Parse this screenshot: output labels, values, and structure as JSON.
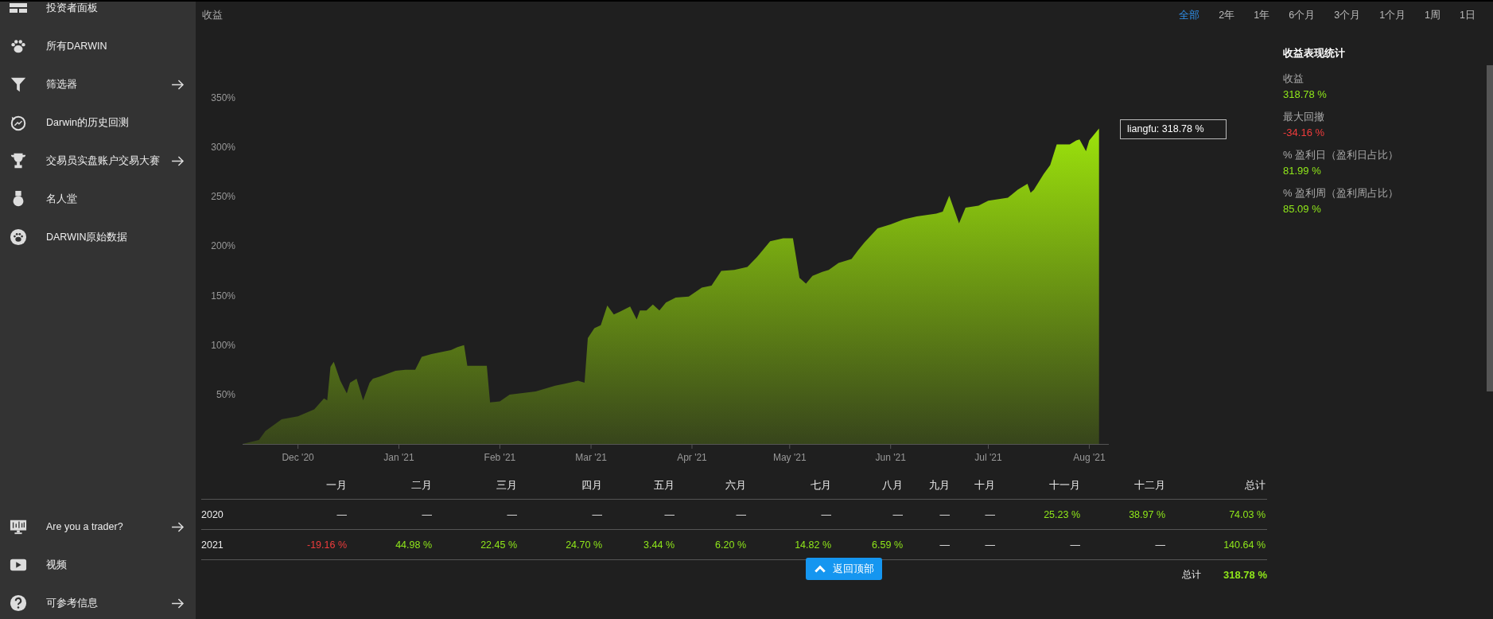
{
  "sidebar": {
    "items": [
      {
        "kind": "dashboard",
        "label": "投资者面板",
        "submenu": false
      },
      {
        "kind": "paw",
        "label": "所有DARWIN",
        "submenu": false
      },
      {
        "kind": "filter",
        "label": "筛选器",
        "submenu": true
      },
      {
        "kind": "history",
        "label": "Darwin的历史回测",
        "submenu": false
      },
      {
        "kind": "trophy",
        "label": "交易员实盘账户交易大赛",
        "submenu": true
      },
      {
        "kind": "medal",
        "label": "名人堂",
        "submenu": false
      },
      {
        "kind": "paw-circle",
        "label": "DARWIN原始数据",
        "submenu": false
      }
    ],
    "bottom_items": [
      {
        "kind": "monitor",
        "label": "Are you a trader?",
        "submenu": true
      },
      {
        "kind": "video",
        "label": "视频",
        "submenu": false
      },
      {
        "kind": "help",
        "label": "可参考信息",
        "submenu": true
      }
    ]
  },
  "chart_panel": {
    "title": "收益",
    "periods": [
      {
        "label": "全部",
        "selected": true
      },
      {
        "label": "2年",
        "selected": false
      },
      {
        "label": "1年",
        "selected": false
      },
      {
        "label": "6个月",
        "selected": false
      },
      {
        "label": "3个月",
        "selected": false
      },
      {
        "label": "1个月",
        "selected": false
      },
      {
        "label": "1周",
        "selected": false
      },
      {
        "label": "1日",
        "selected": false
      }
    ],
    "tooltip": "liangfu: 318.78 %",
    "chart_data": {
      "type": "area",
      "x": [
        "2020-11-14",
        "2020-11-19",
        "2020-11-21",
        "2020-11-26",
        "2020-12-01",
        "2020-12-06",
        "2020-12-09",
        "2020-12-10",
        "2020-12-11",
        "2020-12-12",
        "2020-12-14",
        "2020-12-16",
        "2020-12-17",
        "2020-12-19",
        "2020-12-21",
        "2020-12-23",
        "2020-12-24",
        "2020-12-26",
        "2020-12-31",
        "2021-01-03",
        "2021-01-06",
        "2021-01-08",
        "2021-01-11",
        "2021-01-14",
        "2021-01-17",
        "2021-01-19",
        "2021-01-21",
        "2021-01-22",
        "2021-01-28",
        "2021-01-29",
        "2021-02-01",
        "2021-02-04",
        "2021-02-12",
        "2021-02-18",
        "2021-02-21",
        "2021-02-25",
        "2021-02-27",
        "2021-02-28",
        "2021-03-02",
        "2021-03-04",
        "2021-03-06",
        "2021-03-08",
        "2021-03-10",
        "2021-03-13",
        "2021-03-15",
        "2021-03-16",
        "2021-03-18",
        "2021-03-20",
        "2021-03-22",
        "2021-03-24",
        "2021-03-27",
        "2021-03-31",
        "2021-04-04",
        "2021-04-07",
        "2021-04-10",
        "2021-04-14",
        "2021-04-18",
        "2021-04-21",
        "2021-04-25",
        "2021-04-29",
        "2021-05-02",
        "2021-05-04",
        "2021-05-06",
        "2021-05-08",
        "2021-05-11",
        "2021-05-13",
        "2021-05-16",
        "2021-05-20",
        "2021-05-22",
        "2021-05-24",
        "2021-05-28",
        "2021-06-01",
        "2021-06-05",
        "2021-06-09",
        "2021-06-15",
        "2021-06-17",
        "2021-06-19",
        "2021-06-22",
        "2021-06-24",
        "2021-06-28",
        "2021-07-01",
        "2021-07-07",
        "2021-07-10",
        "2021-07-13",
        "2021-07-14",
        "2021-07-15",
        "2021-07-18",
        "2021-07-20",
        "2021-07-22",
        "2021-07-26",
        "2021-07-28",
        "2021-07-29",
        "2021-07-31",
        "2021-08-01",
        "2021-08-03",
        "2021-08-04"
      ],
      "series": [
        {
          "color": "#a6f20a",
          "values": [
            0,
            4,
            13,
            25,
            28,
            35,
            46,
            44,
            78,
            83,
            64,
            51,
            62,
            66,
            44,
            62,
            66,
            68,
            74,
            75,
            75,
            88,
            91,
            93,
            95,
            98,
            100,
            79,
            79,
            42,
            43,
            50,
            53,
            59,
            61,
            64,
            62,
            107,
            117,
            120,
            140,
            131,
            134,
            139,
            126,
            135,
            135,
            141,
            135,
            143,
            148,
            149,
            158,
            160,
            175,
            176,
            179,
            189,
            205,
            208,
            208,
            168,
            162,
            170,
            174,
            176,
            183,
            187,
            196,
            204,
            218,
            222,
            227,
            230,
            233,
            235,
            251,
            223,
            239,
            241,
            246,
            249,
            257,
            263,
            254,
            257,
            273,
            282,
            303,
            303,
            307,
            308,
            296,
            307,
            315,
            319
          ]
        }
      ],
      "xlim": [
        "2020-11-14",
        "2021-08-07"
      ],
      "ylim": [
        0,
        350
      ],
      "xticks": [
        {
          "value": "2020-12-01",
          "label": "Dec '20"
        },
        {
          "value": "2021-01-01",
          "label": "Jan '21"
        },
        {
          "value": "2021-02-01",
          "label": "Feb '21"
        },
        {
          "value": "2021-03-01",
          "label": "Mar '21"
        },
        {
          "value": "2021-04-01",
          "label": "Apr '21"
        },
        {
          "value": "2021-05-01",
          "label": "May '21"
        },
        {
          "value": "2021-06-01",
          "label": "Jun '21"
        },
        {
          "value": "2021-07-01",
          "label": "Jul '21"
        },
        {
          "value": "2021-08-01",
          "label": "Aug '21"
        }
      ],
      "yticks": [
        {
          "value": 50,
          "label": "50%"
        },
        {
          "value": 100,
          "label": "100%"
        },
        {
          "value": 150,
          "label": "150%"
        },
        {
          "value": 200,
          "label": "200%"
        },
        {
          "value": 250,
          "label": "250%"
        },
        {
          "value": 300,
          "label": "300%"
        },
        {
          "value": 350,
          "label": "350%"
        }
      ]
    }
  },
  "stats": {
    "title": "收益表现统计",
    "items": [
      {
        "label": "收益",
        "value": "318.78 %",
        "kind": "gain"
      },
      {
        "label": "最大回撤",
        "value": "-34.16 %",
        "kind": "loss"
      },
      {
        "label": "% 盈利日（盈利日占比）",
        "value": "81.99 %",
        "kind": "gain"
      },
      {
        "label": "% 盈利周（盈利周占比）",
        "value": "85.09 %",
        "kind": "gain"
      }
    ]
  },
  "monthly_table": {
    "columns": [
      "一月",
      "二月",
      "三月",
      "四月",
      "五月",
      "六月",
      "七月",
      "八月",
      "九月",
      "十月",
      "十一月",
      "十二月",
      "总计"
    ],
    "rows": [
      {
        "year": "2020",
        "cells": [
          {
            "text": "—",
            "kind": "empty"
          },
          {
            "text": "—",
            "kind": "empty"
          },
          {
            "text": "—",
            "kind": "empty"
          },
          {
            "text": "—",
            "kind": "empty"
          },
          {
            "text": "—",
            "kind": "empty"
          },
          {
            "text": "—",
            "kind": "empty"
          },
          {
            "text": "—",
            "kind": "empty"
          },
          {
            "text": "—",
            "kind": "empty"
          },
          {
            "text": "—",
            "kind": "empty"
          },
          {
            "text": "—",
            "kind": "empty"
          },
          {
            "text": "25.23 %",
            "kind": "gain"
          },
          {
            "text": "38.97 %",
            "kind": "gain"
          },
          {
            "text": "74.03 %",
            "kind": "gain"
          }
        ]
      },
      {
        "year": "2021",
        "cells": [
          {
            "text": "-19.16 %",
            "kind": "loss"
          },
          {
            "text": "44.98 %",
            "kind": "gain"
          },
          {
            "text": "22.45 %",
            "kind": "gain"
          },
          {
            "text": "24.70 %",
            "kind": "gain"
          },
          {
            "text": "3.44 %",
            "kind": "gain"
          },
          {
            "text": "6.20 %",
            "kind": "gain"
          },
          {
            "text": "14.82 %",
            "kind": "gain"
          },
          {
            "text": "6.59 %",
            "kind": "gain"
          },
          {
            "text": "—",
            "kind": "empty"
          },
          {
            "text": "—",
            "kind": "empty"
          },
          {
            "text": "—",
            "kind": "empty"
          },
          {
            "text": "—",
            "kind": "empty"
          },
          {
            "text": "140.64 %",
            "kind": "gain"
          }
        ]
      }
    ],
    "total_label": "总计",
    "total_value": "318.78 %"
  },
  "back_to_top": {
    "label": "返回顶部"
  }
}
